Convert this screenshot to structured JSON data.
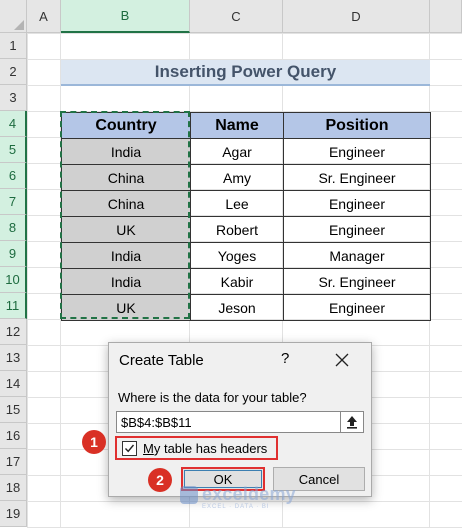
{
  "columns": [
    "A",
    "B",
    "C",
    "D"
  ],
  "rows": [
    "1",
    "2",
    "3",
    "4",
    "5",
    "6",
    "7",
    "8",
    "9",
    "10",
    "11",
    "12",
    "13",
    "14",
    "15",
    "16",
    "17",
    "18",
    "19"
  ],
  "title": "Inserting Power Query",
  "table": {
    "headers": [
      "Country",
      "Name",
      "Position"
    ],
    "rows": [
      [
        "India",
        "Agar",
        "Engineer"
      ],
      [
        "China",
        "Amy",
        "Sr. Engineer"
      ],
      [
        "China",
        "Lee",
        "Engineer"
      ],
      [
        "UK",
        "Robert",
        "Engineer"
      ],
      [
        "India",
        "Yoges",
        "Manager"
      ],
      [
        "India",
        "Kabir",
        "Sr. Engineer"
      ],
      [
        "UK",
        "Jeson",
        "Engineer"
      ]
    ]
  },
  "dialog": {
    "title": "Create Table",
    "help": "?",
    "prompt": "Where is the data for your table?",
    "range_value": "$B$4:$B$11",
    "checkbox_label": "My table has headers",
    "checkbox_checked": true,
    "ok_label": "OK",
    "cancel_label": "Cancel"
  },
  "steps": [
    "1",
    "2"
  ],
  "watermark": {
    "name": "exceldemy",
    "tagline": "EXCEL · DATA · BI"
  },
  "colors": {
    "header_fill": "#b4c6e7",
    "title_fill": "#dce6f2",
    "selection": "#217346",
    "marker": "#d93025"
  }
}
